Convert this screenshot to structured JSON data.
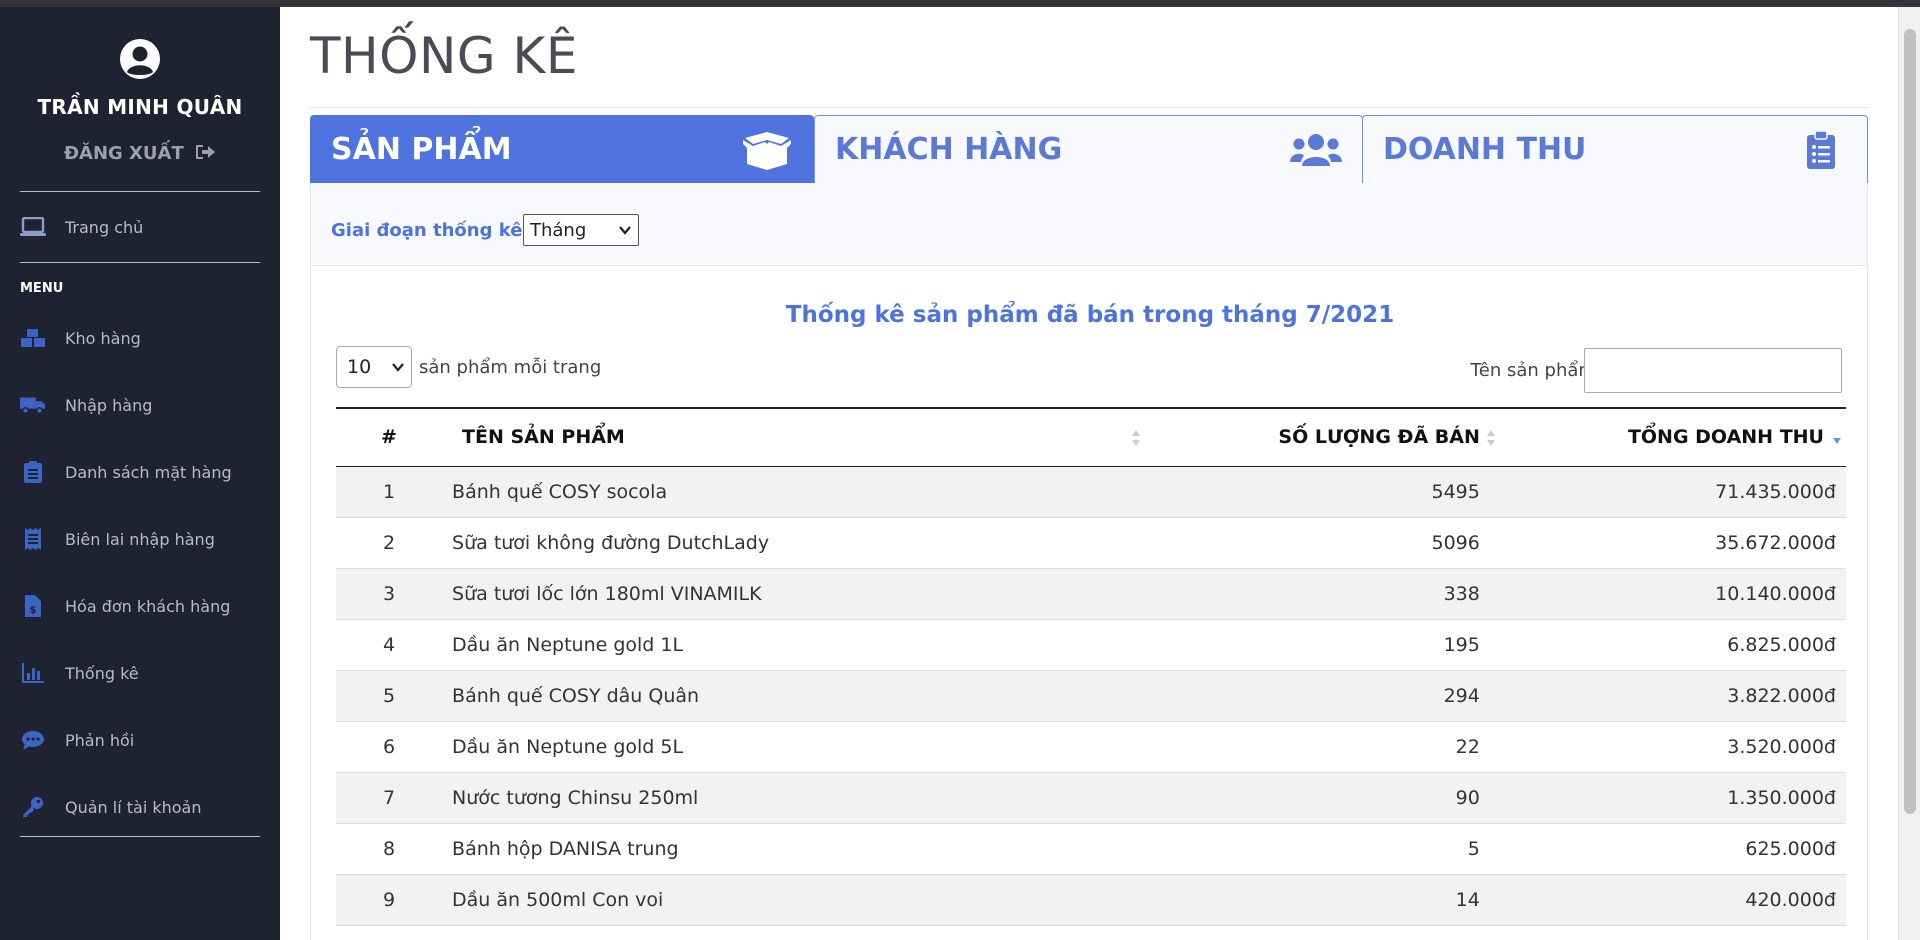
{
  "sidebar": {
    "user_name": "TRẦN MINH QUÂN",
    "logout_label": "ĐĂNG XUẤT",
    "home_label": "Trang chủ",
    "menu_heading": "MENU",
    "items": [
      {
        "label": "Kho hàng",
        "icon": "boxes-icon"
      },
      {
        "label": "Nhập hàng",
        "icon": "truck-icon"
      },
      {
        "label": "Danh sách mặt hàng",
        "icon": "clipboard-list-icon"
      },
      {
        "label": "Biên lai nhập hàng",
        "icon": "receipt-icon"
      },
      {
        "label": "Hóa đơn khách hàng",
        "icon": "invoice-dollar-icon"
      },
      {
        "label": "Thống kê",
        "icon": "chart-bar-icon"
      },
      {
        "label": "Phản hồi",
        "icon": "comment-dots-icon"
      },
      {
        "label": "Quản lí tài khoản",
        "icon": "key-icon"
      }
    ]
  },
  "page": {
    "title": "THỐNG KÊ"
  },
  "tabs": [
    {
      "label": "SẢN PHẨM",
      "icon": "box-open-icon",
      "active": true
    },
    {
      "label": "KHÁCH HÀNG",
      "icon": "users-icon",
      "active": false
    },
    {
      "label": "DOANH THU",
      "icon": "clipboard-list-icon",
      "active": false
    }
  ],
  "filter": {
    "label": "Giai đoạn thống kê:",
    "selected": "Tháng"
  },
  "report": {
    "title": "Thống kê sản phẩm đã bán trong tháng 7/2021",
    "page_length": "10",
    "page_length_label": "sản phẩm mỗi trang",
    "search_label": "Tên sản phẩm:",
    "search_value": ""
  },
  "table": {
    "columns": [
      "#",
      "TÊN SẢN PHẨM",
      "SỐ LƯỢNG ĐÃ BÁN",
      "TỔNG DOANH THU"
    ],
    "rows": [
      {
        "no": "1",
        "name": "Bánh quế COSY socola",
        "qty": "5495",
        "revenue": "71.435.000đ"
      },
      {
        "no": "2",
        "name": "Sữa tươi không đường DutchLady",
        "qty": "5096",
        "revenue": "35.672.000đ"
      },
      {
        "no": "3",
        "name": "Sữa tươi lốc lớn 180ml VINAMILK",
        "qty": "338",
        "revenue": "10.140.000đ"
      },
      {
        "no": "4",
        "name": "Dầu ăn Neptune gold 1L",
        "qty": "195",
        "revenue": "6.825.000đ"
      },
      {
        "no": "5",
        "name": "Bánh quế COSY dâu Quân",
        "qty": "294",
        "revenue": "3.822.000đ"
      },
      {
        "no": "6",
        "name": "Dầu ăn Neptune gold 5L",
        "qty": "22",
        "revenue": "3.520.000đ"
      },
      {
        "no": "7",
        "name": "Nước tương Chinsu 250ml",
        "qty": "90",
        "revenue": "1.350.000đ"
      },
      {
        "no": "8",
        "name": "Bánh hộp DANISA trung",
        "qty": "5",
        "revenue": "625.000đ"
      },
      {
        "no": "9",
        "name": "Dầu ăn 500ml Con voi",
        "qty": "14",
        "revenue": "420.000đ"
      }
    ]
  },
  "colors": {
    "primary": "#4e73df",
    "sidebar_bg": "#1f2231"
  }
}
